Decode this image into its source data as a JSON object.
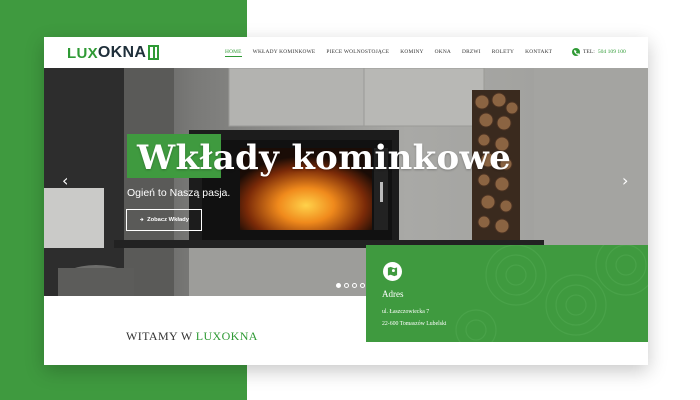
{
  "header": {
    "logo": {
      "lux": "LUX",
      "okna": "OKNA"
    },
    "nav": [
      "HOME",
      "WKŁADY KOMINKOWE",
      "PIECE WOLNOSTOJĄCE",
      "KOMINY",
      "OKNA",
      "DRZWI",
      "ROLETY",
      "KONTAKT"
    ],
    "active_nav": "HOME",
    "phone_label": "TEL:",
    "phone_number": "504 109 100",
    "phone_icon": "phone-icon"
  },
  "hero": {
    "title": "Wkłady kominkowe",
    "subtitle": "Ogień to Naszą pasja.",
    "button_label": "Zobacz Wkłady",
    "prev_arrow": "‹",
    "next_arrow": "›",
    "slides_count": 4,
    "active_slide": 1
  },
  "welcome": {
    "prefix": "WITAMY W",
    "brand": "LUXOKNA"
  },
  "address": {
    "icon": "map-icon",
    "title": "Adres",
    "line1": "ul. Łaszczowiecka 7",
    "line2": "22-600 Tomaszów Lubelski"
  },
  "colors": {
    "brand_green": "#3f9a3f",
    "logo_dark": "#1f2f3a",
    "white": "#ffffff"
  }
}
